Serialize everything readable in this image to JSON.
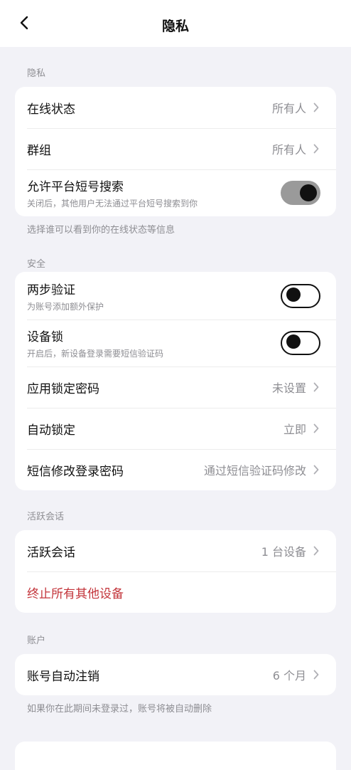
{
  "nav": {
    "title": "隐私",
    "back_icon": "chevron-left-icon"
  },
  "sections": {
    "privacy": {
      "header": "隐私",
      "online_status": {
        "title": "在线状态",
        "value": "所有人"
      },
      "groups": {
        "title": "群组",
        "value": "所有人"
      },
      "short_id_search": {
        "title": "允许平台短号搜索",
        "subtitle": "关闭后，其他用户无法通过平台短号搜索到你",
        "enabled": true
      },
      "footnote": "选择谁可以看到你的在线状态等信息"
    },
    "security": {
      "header": "安全",
      "two_step": {
        "title": "两步验证",
        "subtitle": "为账号添加额外保护",
        "enabled": false
      },
      "device_lock": {
        "title": "设备锁",
        "subtitle": "开启后，新设备登录需要短信验证码",
        "enabled": false
      },
      "app_lock": {
        "title": "应用锁定密码",
        "value": "未设置"
      },
      "auto_lock": {
        "title": "自动锁定",
        "value": "立即"
      },
      "sms_password": {
        "title": "短信修改登录密码",
        "value": "通过短信验证码修改"
      }
    },
    "sessions": {
      "header": "活跃会话",
      "active": {
        "title": "活跃会话",
        "value": "1 台设备"
      },
      "terminate": {
        "title": "终止所有其他设备"
      }
    },
    "account": {
      "header": "账户",
      "auto_delete": {
        "title": "账号自动注销",
        "value": "6 个月"
      },
      "footnote": "如果你在此期间未登录过，账号将被自动删除"
    }
  },
  "colors": {
    "background": "#f2f2f7",
    "danger": "#c3343a",
    "secondary_text": "#8e8e93"
  }
}
